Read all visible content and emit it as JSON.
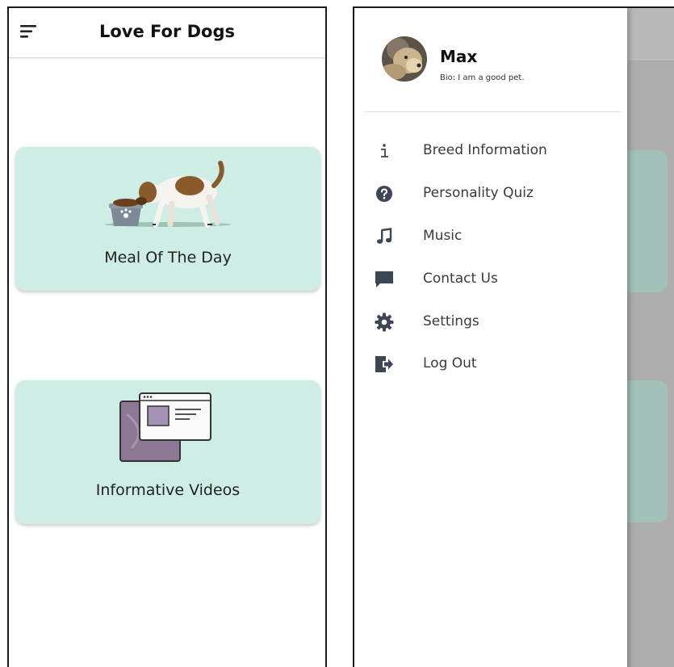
{
  "left_screen": {
    "appbar": {
      "title": "Love For Dogs",
      "menu_icon": "menu-icon"
    },
    "cards": [
      {
        "label": "Meal Of The Day",
        "illustration": "dog-eating-illustration"
      },
      {
        "label": "Informative Videos",
        "illustration": "video-windows-illustration"
      }
    ]
  },
  "right_screen": {
    "drawer": {
      "profile": {
        "name": "Max",
        "bio": "Bio: I am a good pet.",
        "avatar": "dog-avatar"
      },
      "items": [
        {
          "label": "Breed Information",
          "icon": "info-icon"
        },
        {
          "label": "Personality Quiz",
          "icon": "help-icon"
        },
        {
          "label": "Music",
          "icon": "music-note-icon"
        },
        {
          "label": "Contact Us",
          "icon": "chat-icon"
        },
        {
          "label": "Settings",
          "icon": "gear-icon"
        },
        {
          "label": "Log Out",
          "icon": "logout-icon"
        }
      ]
    }
  },
  "colors": {
    "card_background": "#ceeee5",
    "scrim": "#adadad",
    "icon_color": "#3d4654",
    "dog_brown": "#8b5a2b"
  }
}
